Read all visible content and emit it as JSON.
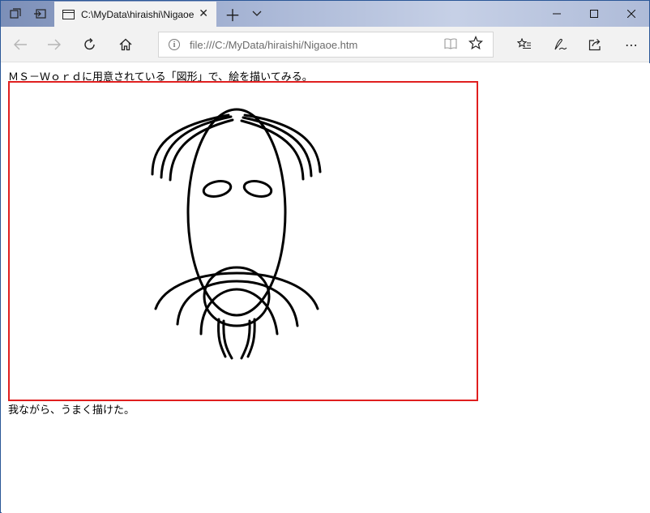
{
  "browser": {
    "tab": {
      "title": "C:\\MyData\\hiraishi\\Nigaoe.htm"
    },
    "address": {
      "url": "file:///C:/MyData/hiraishi/Nigaoe.htm"
    },
    "icons": {
      "tab_manager": "tabs-icon",
      "set_aside": "set-aside-icon",
      "new_tab": "plus-icon",
      "tab_preview": "chevron-down-icon",
      "minimize": "minimize-icon",
      "maximize": "maximize-icon",
      "close": "close-icon",
      "back": "back-arrow-icon",
      "forward": "forward-arrow-icon",
      "refresh": "refresh-icon",
      "home": "home-icon",
      "favorites": "favorites-icon",
      "notes": "pen-icon",
      "share": "share-icon",
      "more": "more-icon"
    }
  },
  "page": {
    "intro_text": "ＭＳ－Ｗｏｒｄに用意されている「図形」で、絵を描いてみる。",
    "closing_text": "我ながら、うまく描けた。",
    "frame_color": "#e01f1f",
    "drawing": "face-drawing"
  }
}
